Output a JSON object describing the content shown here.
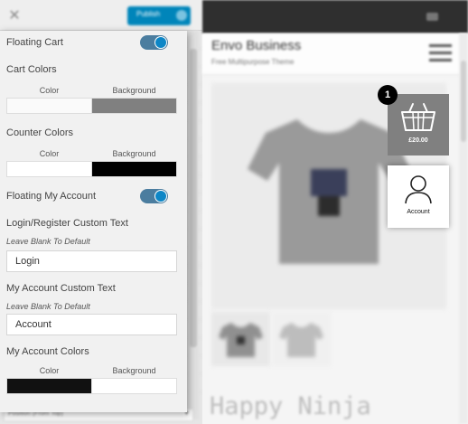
{
  "customizer": {
    "close_icon": "close-x-icon",
    "publish_label": "Publish",
    "bottom_select_text": "Position (From Top)"
  },
  "panel": {
    "floating_cart": {
      "label": "Floating Cart",
      "enabled": true
    },
    "cart_colors": {
      "label": "Cart Colors",
      "color_title": "Color",
      "background_title": "Background",
      "color": "#fafafa",
      "background": "#808080"
    },
    "counter_colors": {
      "label": "Counter Colors",
      "color_title": "Color",
      "background_title": "Background",
      "color": "#ffffff",
      "background": "#000000"
    },
    "floating_account": {
      "label": "Floating My Account",
      "enabled": true
    },
    "login_text": {
      "label": "Login/Register Custom Text",
      "hint": "Leave Blank To Default",
      "value": "Login"
    },
    "account_text": {
      "label": "My Account Custom Text",
      "hint": "Leave Blank To Default",
      "value": "Account"
    },
    "account_colors": {
      "label": "My Account Colors",
      "color_title": "Color",
      "background_title": "Background",
      "color": "#111111",
      "background": "#ffffff"
    }
  },
  "preview": {
    "site_title": "Envo Business",
    "site_tagline": "Free Multipurpose Theme",
    "menu_icon": "hamburger-menu-icon",
    "product_title": "Happy Ninja",
    "cart": {
      "counter": "1",
      "amount": "£20.00",
      "icon": "basket-icon",
      "color": "#808080"
    },
    "account": {
      "label": "Account",
      "icon": "user-icon"
    }
  },
  "accent_color": "#0d86c6"
}
